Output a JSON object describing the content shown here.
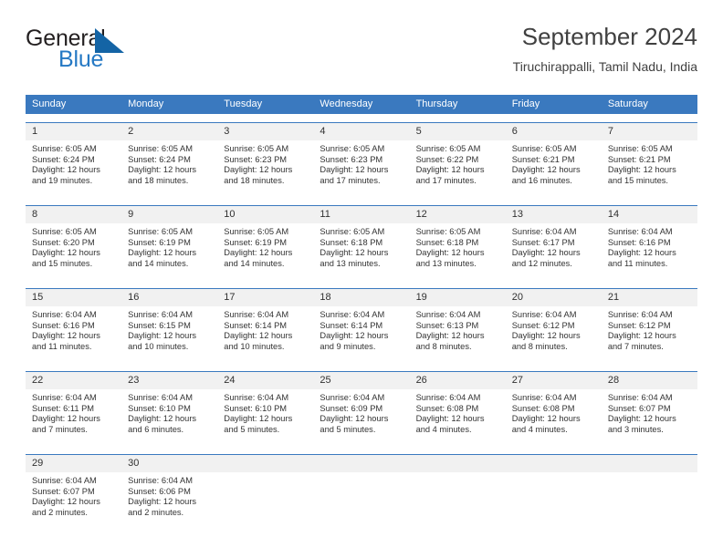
{
  "brand": {
    "name_part1": "General",
    "name_part2": "Blue",
    "flag_color": "#1464a5",
    "blue_text_color": "#2579c4"
  },
  "header": {
    "title": "September 2024",
    "subtitle": "Tiruchirappalli, Tamil Nadu, India"
  },
  "calendar": {
    "header_bg": "#3a79bf",
    "day_band_bg": "#f1f1f1",
    "weekdays": [
      "Sunday",
      "Monday",
      "Tuesday",
      "Wednesday",
      "Thursday",
      "Friday",
      "Saturday"
    ],
    "weeks": [
      [
        {
          "day": "1",
          "sunrise": "Sunrise: 6:05 AM",
          "sunset": "Sunset: 6:24 PM",
          "daylight_line1": "Daylight: 12 hours",
          "daylight_line2": "and 19 minutes."
        },
        {
          "day": "2",
          "sunrise": "Sunrise: 6:05 AM",
          "sunset": "Sunset: 6:24 PM",
          "daylight_line1": "Daylight: 12 hours",
          "daylight_line2": "and 18 minutes."
        },
        {
          "day": "3",
          "sunrise": "Sunrise: 6:05 AM",
          "sunset": "Sunset: 6:23 PM",
          "daylight_line1": "Daylight: 12 hours",
          "daylight_line2": "and 18 minutes."
        },
        {
          "day": "4",
          "sunrise": "Sunrise: 6:05 AM",
          "sunset": "Sunset: 6:23 PM",
          "daylight_line1": "Daylight: 12 hours",
          "daylight_line2": "and 17 minutes."
        },
        {
          "day": "5",
          "sunrise": "Sunrise: 6:05 AM",
          "sunset": "Sunset: 6:22 PM",
          "daylight_line1": "Daylight: 12 hours",
          "daylight_line2": "and 17 minutes."
        },
        {
          "day": "6",
          "sunrise": "Sunrise: 6:05 AM",
          "sunset": "Sunset: 6:21 PM",
          "daylight_line1": "Daylight: 12 hours",
          "daylight_line2": "and 16 minutes."
        },
        {
          "day": "7",
          "sunrise": "Sunrise: 6:05 AM",
          "sunset": "Sunset: 6:21 PM",
          "daylight_line1": "Daylight: 12 hours",
          "daylight_line2": "and 15 minutes."
        }
      ],
      [
        {
          "day": "8",
          "sunrise": "Sunrise: 6:05 AM",
          "sunset": "Sunset: 6:20 PM",
          "daylight_line1": "Daylight: 12 hours",
          "daylight_line2": "and 15 minutes."
        },
        {
          "day": "9",
          "sunrise": "Sunrise: 6:05 AM",
          "sunset": "Sunset: 6:19 PM",
          "daylight_line1": "Daylight: 12 hours",
          "daylight_line2": "and 14 minutes."
        },
        {
          "day": "10",
          "sunrise": "Sunrise: 6:05 AM",
          "sunset": "Sunset: 6:19 PM",
          "daylight_line1": "Daylight: 12 hours",
          "daylight_line2": "and 14 minutes."
        },
        {
          "day": "11",
          "sunrise": "Sunrise: 6:05 AM",
          "sunset": "Sunset: 6:18 PM",
          "daylight_line1": "Daylight: 12 hours",
          "daylight_line2": "and 13 minutes."
        },
        {
          "day": "12",
          "sunrise": "Sunrise: 6:05 AM",
          "sunset": "Sunset: 6:18 PM",
          "daylight_line1": "Daylight: 12 hours",
          "daylight_line2": "and 13 minutes."
        },
        {
          "day": "13",
          "sunrise": "Sunrise: 6:04 AM",
          "sunset": "Sunset: 6:17 PM",
          "daylight_line1": "Daylight: 12 hours",
          "daylight_line2": "and 12 minutes."
        },
        {
          "day": "14",
          "sunrise": "Sunrise: 6:04 AM",
          "sunset": "Sunset: 6:16 PM",
          "daylight_line1": "Daylight: 12 hours",
          "daylight_line2": "and 11 minutes."
        }
      ],
      [
        {
          "day": "15",
          "sunrise": "Sunrise: 6:04 AM",
          "sunset": "Sunset: 6:16 PM",
          "daylight_line1": "Daylight: 12 hours",
          "daylight_line2": "and 11 minutes."
        },
        {
          "day": "16",
          "sunrise": "Sunrise: 6:04 AM",
          "sunset": "Sunset: 6:15 PM",
          "daylight_line1": "Daylight: 12 hours",
          "daylight_line2": "and 10 minutes."
        },
        {
          "day": "17",
          "sunrise": "Sunrise: 6:04 AM",
          "sunset": "Sunset: 6:14 PM",
          "daylight_line1": "Daylight: 12 hours",
          "daylight_line2": "and 10 minutes."
        },
        {
          "day": "18",
          "sunrise": "Sunrise: 6:04 AM",
          "sunset": "Sunset: 6:14 PM",
          "daylight_line1": "Daylight: 12 hours",
          "daylight_line2": "and 9 minutes."
        },
        {
          "day": "19",
          "sunrise": "Sunrise: 6:04 AM",
          "sunset": "Sunset: 6:13 PM",
          "daylight_line1": "Daylight: 12 hours",
          "daylight_line2": "and 8 minutes."
        },
        {
          "day": "20",
          "sunrise": "Sunrise: 6:04 AM",
          "sunset": "Sunset: 6:12 PM",
          "daylight_line1": "Daylight: 12 hours",
          "daylight_line2": "and 8 minutes."
        },
        {
          "day": "21",
          "sunrise": "Sunrise: 6:04 AM",
          "sunset": "Sunset: 6:12 PM",
          "daylight_line1": "Daylight: 12 hours",
          "daylight_line2": "and 7 minutes."
        }
      ],
      [
        {
          "day": "22",
          "sunrise": "Sunrise: 6:04 AM",
          "sunset": "Sunset: 6:11 PM",
          "daylight_line1": "Daylight: 12 hours",
          "daylight_line2": "and 7 minutes."
        },
        {
          "day": "23",
          "sunrise": "Sunrise: 6:04 AM",
          "sunset": "Sunset: 6:10 PM",
          "daylight_line1": "Daylight: 12 hours",
          "daylight_line2": "and 6 minutes."
        },
        {
          "day": "24",
          "sunrise": "Sunrise: 6:04 AM",
          "sunset": "Sunset: 6:10 PM",
          "daylight_line1": "Daylight: 12 hours",
          "daylight_line2": "and 5 minutes."
        },
        {
          "day": "25",
          "sunrise": "Sunrise: 6:04 AM",
          "sunset": "Sunset: 6:09 PM",
          "daylight_line1": "Daylight: 12 hours",
          "daylight_line2": "and 5 minutes."
        },
        {
          "day": "26",
          "sunrise": "Sunrise: 6:04 AM",
          "sunset": "Sunset: 6:08 PM",
          "daylight_line1": "Daylight: 12 hours",
          "daylight_line2": "and 4 minutes."
        },
        {
          "day": "27",
          "sunrise": "Sunrise: 6:04 AM",
          "sunset": "Sunset: 6:08 PM",
          "daylight_line1": "Daylight: 12 hours",
          "daylight_line2": "and 4 minutes."
        },
        {
          "day": "28",
          "sunrise": "Sunrise: 6:04 AM",
          "sunset": "Sunset: 6:07 PM",
          "daylight_line1": "Daylight: 12 hours",
          "daylight_line2": "and 3 minutes."
        }
      ],
      [
        {
          "day": "29",
          "sunrise": "Sunrise: 6:04 AM",
          "sunset": "Sunset: 6:07 PM",
          "daylight_line1": "Daylight: 12 hours",
          "daylight_line2": "and 2 minutes."
        },
        {
          "day": "30",
          "sunrise": "Sunrise: 6:04 AM",
          "sunset": "Sunset: 6:06 PM",
          "daylight_line1": "Daylight: 12 hours",
          "daylight_line2": "and 2 minutes."
        },
        {
          "day": "",
          "sunrise": "",
          "sunset": "",
          "daylight_line1": "",
          "daylight_line2": ""
        },
        {
          "day": "",
          "sunrise": "",
          "sunset": "",
          "daylight_line1": "",
          "daylight_line2": ""
        },
        {
          "day": "",
          "sunrise": "",
          "sunset": "",
          "daylight_line1": "",
          "daylight_line2": ""
        },
        {
          "day": "",
          "sunrise": "",
          "sunset": "",
          "daylight_line1": "",
          "daylight_line2": ""
        },
        {
          "day": "",
          "sunrise": "",
          "sunset": "",
          "daylight_line1": "",
          "daylight_line2": ""
        }
      ]
    ]
  }
}
